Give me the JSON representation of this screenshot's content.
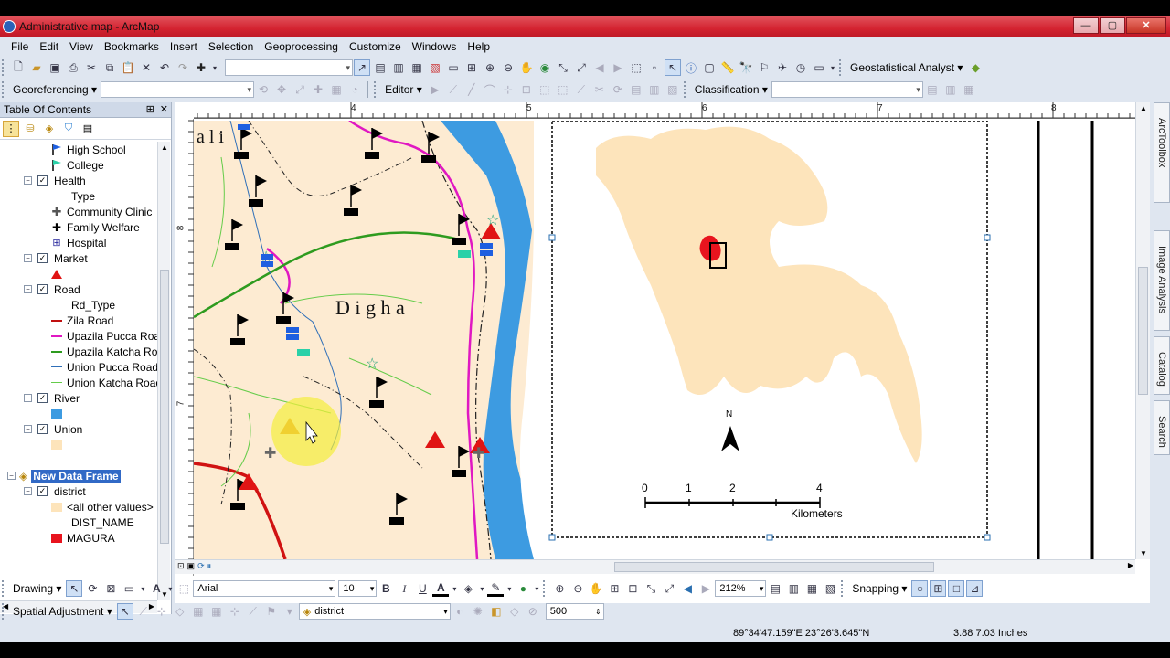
{
  "window": {
    "title": "Administrative map - ArcMap",
    "min": "—",
    "max": "▢",
    "close": "✕"
  },
  "menu": [
    "File",
    "Edit",
    "View",
    "Bookmarks",
    "Insert",
    "Selection",
    "Geoprocessing",
    "Customize",
    "Windows",
    "Help"
  ],
  "toolbars": {
    "geostat_label": "Geostatistical Analyst ▾",
    "georef_label": "Georeferencing ▾",
    "editor_label": "Editor ▾",
    "classification_label": "Classification ▾"
  },
  "toc": {
    "title": "Table Of Contents",
    "pin": "⊞",
    "close": "✕",
    "items": [
      {
        "kind": "legend",
        "label": "High School",
        "indent": 3,
        "symbol": "flag-blue"
      },
      {
        "kind": "legend",
        "label": "College",
        "indent": 3,
        "symbol": "flag-teal"
      },
      {
        "kind": "layer",
        "label": "Health",
        "checked": true
      },
      {
        "kind": "field",
        "label": "Type"
      },
      {
        "kind": "legend",
        "label": "Community Clinic",
        "symbol": "cross-outline"
      },
      {
        "kind": "legend",
        "label": "Family Welfare",
        "symbol": "cross-black"
      },
      {
        "kind": "legend",
        "label": "Hospital",
        "symbol": "hospital"
      },
      {
        "kind": "layer",
        "label": "Market",
        "checked": true
      },
      {
        "kind": "legend",
        "label": "",
        "symbol": "triangle-red"
      },
      {
        "kind": "layer",
        "label": "Road",
        "checked": true
      },
      {
        "kind": "field",
        "label": "Rd_Type"
      },
      {
        "kind": "legend",
        "label": "Zila Road",
        "symbol": "line-darkred"
      },
      {
        "kind": "legend",
        "label": "Upazila Pucca Road",
        "symbol": "line-magenta"
      },
      {
        "kind": "legend",
        "label": "Upazila Katcha Road",
        "symbol": "line-green"
      },
      {
        "kind": "legend",
        "label": "Union Pucca Road",
        "symbol": "line-blue"
      },
      {
        "kind": "legend",
        "label": "Union Katcha Road",
        "symbol": "line-lightgreen"
      },
      {
        "kind": "layer",
        "label": "River",
        "checked": true
      },
      {
        "kind": "legend",
        "label": "",
        "symbol": "box-blue"
      },
      {
        "kind": "layer",
        "label": "Union",
        "checked": true
      },
      {
        "kind": "legend",
        "label": "",
        "symbol": "box-beige"
      },
      {
        "kind": "spacer",
        "label": ""
      },
      {
        "kind": "frame",
        "label": "New Data Frame"
      },
      {
        "kind": "layer",
        "label": "district",
        "checked": true
      },
      {
        "kind": "legend",
        "label": "<all other values>",
        "symbol": "box-beige"
      },
      {
        "kind": "field",
        "label": "DIST_NAME"
      },
      {
        "kind": "legend",
        "label": "MAGURA",
        "symbol": "box-red"
      }
    ]
  },
  "map": {
    "ruler_top": [
      "4",
      "5",
      "6",
      "7",
      "8"
    ],
    "ruler_left": [
      "8",
      "7"
    ],
    "label_digha": "D i g h a",
    "label_ali": "a l i",
    "north": "N",
    "scale_ticks": [
      "0",
      "1",
      "2",
      "4"
    ],
    "scale_unit": "Kilometers"
  },
  "right_tabs": [
    "ArcToolbox",
    "Image Analysis",
    "Catalog",
    "Search"
  ],
  "drawing": {
    "label": "Drawing ▾",
    "font": "Arial",
    "size": "10",
    "bold": "B",
    "italic": "I",
    "underline": "U",
    "zoom": "212%",
    "snapping": "Snapping ▾"
  },
  "spatial": {
    "label": "Spatial Adjustment ▾",
    "layer": "district",
    "value": "500"
  },
  "status": {
    "coords": "89°34'47.159\"E  23°26'3.645\"N",
    "page": "3.88  7.03 Inches"
  }
}
